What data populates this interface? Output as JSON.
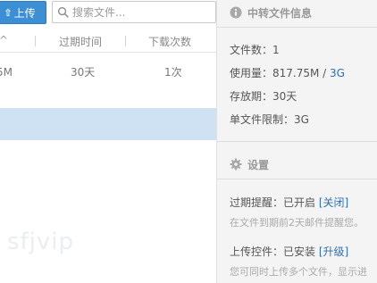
{
  "toolbar": {
    "upload_label": "上传",
    "search_placeholder": "搜索文件..."
  },
  "table": {
    "columns": [
      "过期时间",
      "下载次数"
    ],
    "first_col_mark": "^",
    "rows": [
      {
        "size": "5M",
        "expire": "30天",
        "downloads": "1次"
      }
    ]
  },
  "watermark": "sfjvip",
  "info": {
    "title": "中转文件信息",
    "file_count_label": "文件数：",
    "file_count": "1",
    "usage_label": "使用量：",
    "usage_value": "817.75M",
    "usage_sep": " / ",
    "usage_total": "3G",
    "retention_label": "存放期：",
    "retention_value": "30天",
    "limit_label": "单文件限制：",
    "limit_value": "3G"
  },
  "settings": {
    "title": "设置",
    "expiry_reminder_label": "过期提醒：",
    "expiry_reminder_status": "已开启",
    "expiry_reminder_action": "[关闭]",
    "expiry_reminder_hint": "在文件到期前2天邮件提醒您。",
    "upload_control_label": "上传控件：",
    "upload_control_status": "已安装",
    "upload_control_action": "[升级]",
    "upload_control_hint": "您可同时上传多个文件，显示进"
  },
  "colors": {
    "upload_button": "#3c8fd4",
    "selected_row": "#cfe2f4",
    "link": "#2e6fb2",
    "side_panel": "#f4f4f4"
  },
  "icons": [
    "upload-arrow-icon",
    "search-icon",
    "info-icon",
    "gear-icon"
  ]
}
